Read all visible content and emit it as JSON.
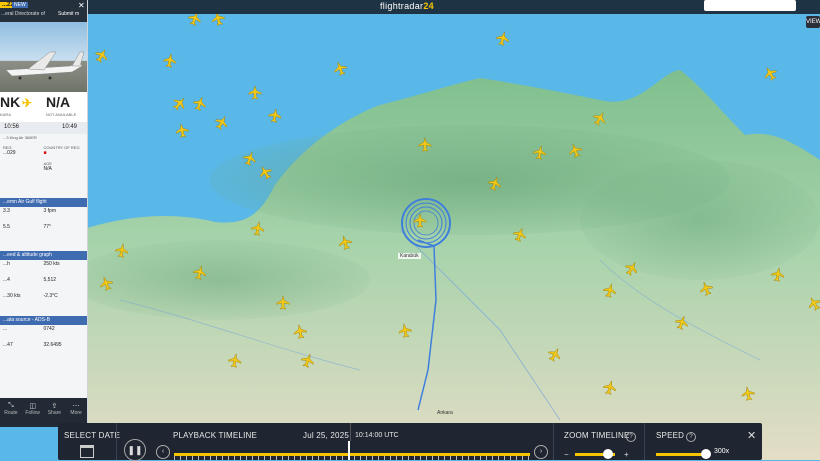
{
  "header": {
    "brand_prefix": "flightradar",
    "brand_suffix": "24"
  },
  "flight": {
    "callsign": "...22",
    "badge": "NEW",
    "operator_line": "...eral Directorate of",
    "operator_tail": "Submit m",
    "from_code": "NK",
    "to_code": "N/A",
    "from_sub": "KARA",
    "to_sub": "NOT AVAILABLE",
    "dep_time": "10:56",
    "arr_time": "10:49",
    "aircraft": "...3 King Air 360ER",
    "reg_label": "REG",
    "reg": "...029",
    "country_label": "COUNTRY OF REG",
    "age_label": "AGE",
    "age": "N/A",
    "sec1": "...emn Air Gulf flight",
    "sec2": "...eed & altitude graph",
    "sec3": "...ata source - ADS-B",
    "kv1": [
      [
        "3.3",
        "3 fpm"
      ],
      [
        "5.5",
        "77°"
      ]
    ],
    "kv2": [
      [
        "...h",
        "250 kts"
      ],
      [
        "...4",
        "5,512"
      ]
    ],
    "kv3": [
      [
        "...y",
        "-2.3°C"
      ],
      [
        "...30 kts",
        ""
      ]
    ],
    "kv4": [
      [
        "...",
        "0742"
      ],
      [
        "...47",
        "32.6495"
      ]
    ],
    "footer_items": [
      {
        "icon": "⤡",
        "label": "Route"
      },
      {
        "icon": "◫",
        "label": "Follow"
      },
      {
        "icon": "⇪",
        "label": "Share"
      },
      {
        "icon": "⋯",
        "label": "More"
      }
    ]
  },
  "map": {
    "city_center": "Karabük",
    "city_south": "Ankara",
    "view_button": "VIEW"
  },
  "playback": {
    "select_date": "SELECT DATE",
    "timeline": "PLAYBACK TIMELINE",
    "date": "Jul 25, 2025",
    "time": "10:14:00 UTC",
    "zoom": "ZOOM TIMELINE",
    "speed": "SPEED",
    "speed_value": "300x",
    "progress": 0.49
  },
  "colors": {
    "sea": "#5ab8e8",
    "land_green": "#8cc79a",
    "accent": "#f6c400",
    "route": "#3f7fdc"
  }
}
